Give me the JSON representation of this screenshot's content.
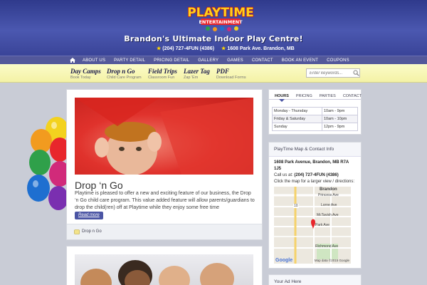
{
  "header": {
    "logo": {
      "line1": "PLAYTIME",
      "line2": "ENTERTAINMENT"
    },
    "tagline": "Brandon's Ultimate Indoor Play Centre!",
    "phone": "(204) 727-4FUN (4386)",
    "address": "1608 Park Ave. Brandon, MB"
  },
  "nav": {
    "home_icon": "home-icon",
    "items": [
      "ABOUT US",
      "PARTY DETAIL",
      "PRICING DETAIL",
      "GALLERY",
      "GAMES",
      "CONTACT",
      "BOOK AN EVENT",
      "COUPONS"
    ]
  },
  "subnav": {
    "items": [
      {
        "title": "Day Camps",
        "desc": "Book Today"
      },
      {
        "title": "Drop n Go",
        "desc": "Child Care Program"
      },
      {
        "title": "Field Trips",
        "desc": "Classroom Fun"
      },
      {
        "title": "Lazer Tag",
        "desc": "Zap 'Em"
      },
      {
        "title": "PDF",
        "desc": "Download Forms"
      }
    ],
    "search_placeholder": "Enter keywords..."
  },
  "post": {
    "title": "Drop ‘n Go",
    "text": "Playtime is pleased to offer a new and exciting feature of our business, the Drop ‘n Go child care program. This value added feature will allow parents/guardians to drop the child(ren) off at Playtime while they enjoy some free time",
    "read_more": "Read more",
    "category": "Drop n Go"
  },
  "sidebar": {
    "tabs": [
      "HOURS",
      "PRICING",
      "PARTIES",
      "CONTACT"
    ],
    "hours": [
      {
        "day": "Monday - Thursday",
        "time": "10am - 9pm"
      },
      {
        "day": "Friday & Saturday",
        "time": "10am - 10pm"
      },
      {
        "day": "Sunday",
        "time": "12pm - 9pm"
      }
    ],
    "map_widget": {
      "title": "PlayTime Map & Contact Info",
      "address": "1608 Park Avenue, Brandon, MB   R7A 1J5",
      "call_label": "Call us at:",
      "phone": "(204) 727-4FUN (4386)",
      "hint": "Click the map for a larger view / directions:",
      "labels": {
        "city": "Brandon",
        "princess": "Princess Ave",
        "lorne": "Lorne Ave",
        "mctavish": "McTavish Ave",
        "park": "Park Ave",
        "richmond": "Richmond Ave",
        "hwy": "10"
      },
      "google": "Google",
      "map_data": "Map data ©2015 Google"
    },
    "ad_title": "Your Ad Here"
  },
  "colors": {
    "header": "#3a4498",
    "nav": "#53589a",
    "subnav": "#f4f2a6",
    "accent": "#4b55a4"
  }
}
